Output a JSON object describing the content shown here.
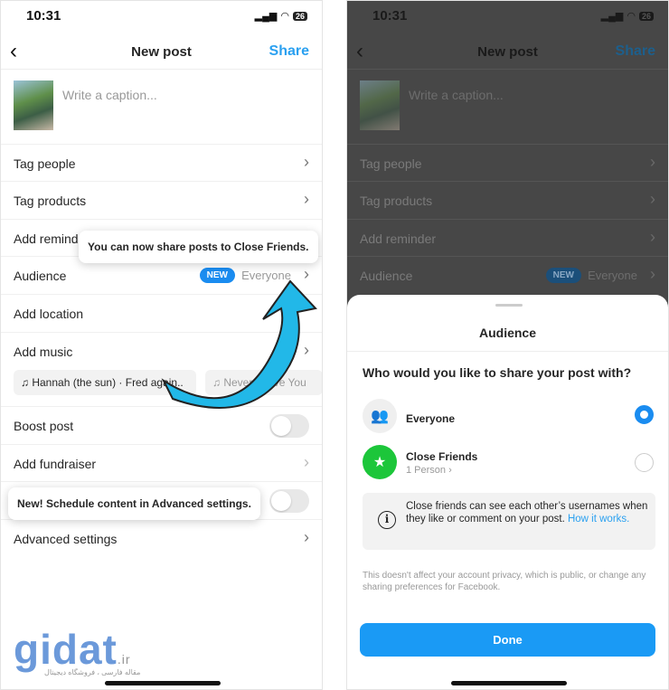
{
  "status": {
    "time": "10:31",
    "battery": "26"
  },
  "header": {
    "back": "‹",
    "title": "New post",
    "share": "Share"
  },
  "caption": {
    "placeholder": "Write a caption..."
  },
  "rows": {
    "tag_people": "Tag people",
    "tag_products": "Tag products",
    "add_reminder": "Add reminder",
    "add_reminder_clipped": "Add remind",
    "audience": "Audience",
    "audience_badge": "NEW",
    "audience_value": "Everyone",
    "add_location": "Add location",
    "add_music": "Add music",
    "boost_post": "Boost post",
    "add_fundraiser": "Add fundraiser",
    "advanced_settings": "Advanced settings"
  },
  "music_chips": [
    "Hannah (the sun) · Fred again..",
    "Never Leave You"
  ],
  "tooltips": {
    "close_friends": "You can now share posts to Close Friends.",
    "schedule": "New! Schedule content in Advanced settings."
  },
  "toggles": {
    "boost_post": false,
    "hidden_row": false
  },
  "sheet": {
    "title": "Audience",
    "question": "Who would you like to share your post with?",
    "options": [
      {
        "label": "Everyone",
        "icon": "people-icon",
        "selected": true
      },
      {
        "label": "Close Friends",
        "sub": "1 Person ›",
        "icon": "star-icon",
        "selected": false
      }
    ],
    "info": "Close friends can see each other’s usernames when they like or comment on your post.",
    "info_link": "How it works.",
    "disclaimer": "This doesn't affect your account privacy, which is public, or change any sharing preferences for Facebook.",
    "done": "Done"
  },
  "watermark": {
    "logo": "gidat",
    "tld": ".ir",
    "tagline": "مقاله فارسی ، فروشگاه دیجیتال"
  },
  "colors": {
    "accent": "#1a8cf0",
    "close_friends": "#1cc63a",
    "arrow": "#22b8e8"
  }
}
